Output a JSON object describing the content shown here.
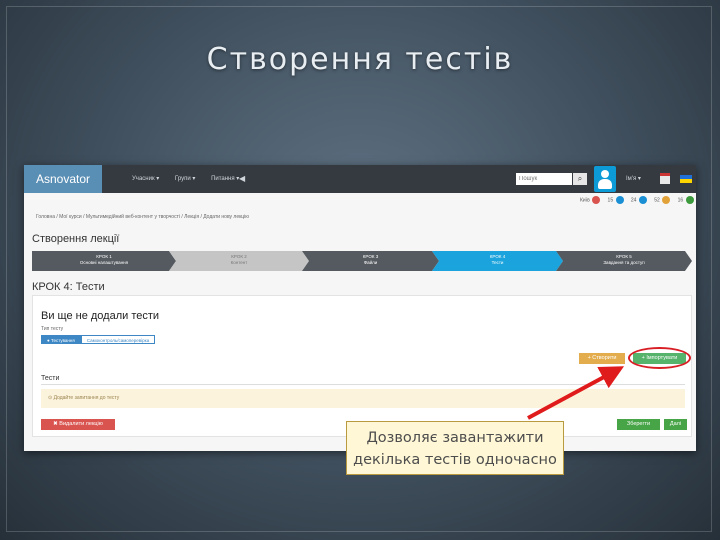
{
  "slide": {
    "title": "Створення тестів"
  },
  "app": {
    "logo": "Asnovator",
    "nav": [
      "Учасник ▾",
      "Групи ▾",
      "Питання ▾"
    ],
    "nav_icon": "◀",
    "search": {
      "placeholder": "Пошук",
      "button_icon": "search-icon"
    },
    "user": "Ім'я ▾",
    "counters": [
      {
        "label": "Київ",
        "value": "12",
        "color": "#d9534f"
      },
      {
        "label": "15",
        "value": "",
        "color": "#1a8fd4"
      },
      {
        "label": "24",
        "value": "",
        "color": "#1a8fd4"
      },
      {
        "label": "52",
        "value": "",
        "color": "#e1a23a"
      },
      {
        "label": "16",
        "value": "",
        "color": "#3c9a3c"
      }
    ]
  },
  "breadcrumb": "Головна / Мої курси / Мультимедійний веб-контент у творчості / Лекція / Додати нову лекцію",
  "page_title": "Створення лекції",
  "steps": [
    {
      "title": "КРОК 1",
      "subtitle": "Основні налаштування",
      "state": "done"
    },
    {
      "title": "КРОК 2",
      "subtitle": "Контент",
      "state": "disabled"
    },
    {
      "title": "КРОК 3",
      "subtitle": "Файли",
      "state": "done"
    },
    {
      "title": "КРОК 4",
      "subtitle": "Тести",
      "state": "active"
    },
    {
      "title": "КРОК 5",
      "subtitle": "Завдання та доступ",
      "state": "done"
    }
  ],
  "step_heading": "КРОК 4: Тести",
  "panel": {
    "empty_title": "Ви ще не додали тести",
    "type_label": "Тип тесту",
    "type_options": [
      "● Тестування",
      "Самоконтроль/самоперевірка"
    ],
    "create_label": "+ Створити",
    "import_label": "+ Імпортувати",
    "tests_label": "Тести",
    "warning": "⊙  Додайте запитання до тесту",
    "delete_label": "✖ Видалити лекцію",
    "save_label": "Зберегти",
    "next_label": "Далі"
  },
  "callout": {
    "line1": "Дозволяє завантажити",
    "line2": "декілька тестів одночасно"
  },
  "colors": {
    "accent_active": "#1aa3dc",
    "step_default": "#555a60",
    "step_disabled": "#c5c5c5",
    "create": "#e3ad4d",
    "import": "#55b36b",
    "danger": "#d9534f",
    "highlight_red": "#d91f26"
  }
}
